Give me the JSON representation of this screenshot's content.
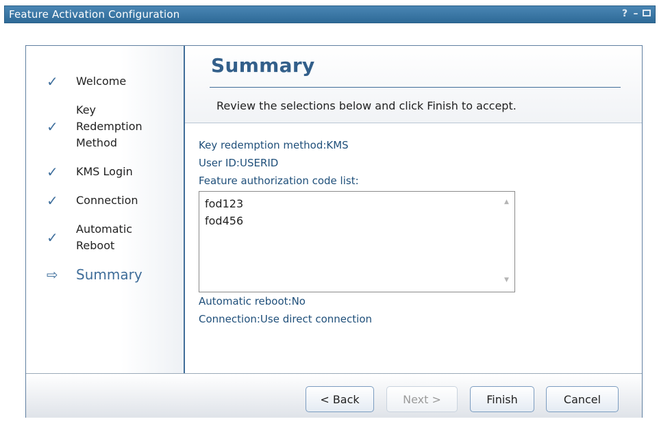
{
  "window": {
    "title": "Feature Activation Configuration",
    "controls": {
      "help": "?",
      "minimize": "–"
    }
  },
  "nav": {
    "items": [
      {
        "label": "Welcome",
        "state": "done",
        "icon": "check-icon"
      },
      {
        "label": "Key\nRedemption\nMethod",
        "state": "done",
        "icon": "check-icon"
      },
      {
        "label": "KMS Login",
        "state": "done",
        "icon": "check-icon"
      },
      {
        "label": "Connection",
        "state": "done",
        "icon": "check-icon"
      },
      {
        "label": "Automatic\nReboot",
        "state": "done",
        "icon": "check-icon"
      },
      {
        "label": "Summary",
        "state": "current",
        "icon": "arrow-right-icon"
      }
    ]
  },
  "main": {
    "title": "Summary",
    "instructions": "Review the selections below and click Finish to accept.",
    "key_redemption": "Key redemption method:KMS",
    "user_id": "User ID:USERID",
    "code_list_label": "Feature authorization code list:",
    "codes": [
      "fod123",
      "fod456"
    ],
    "automatic_reboot": "Automatic reboot:No",
    "connection": "Connection:Use direct connection"
  },
  "footer": {
    "back": "< Back",
    "next": "Next >",
    "finish": "Finish",
    "cancel": "Cancel"
  },
  "colors": {
    "titlebar": "#2e6a97",
    "accent": "#3f6d99",
    "summary_text": "#1f4f7a"
  }
}
